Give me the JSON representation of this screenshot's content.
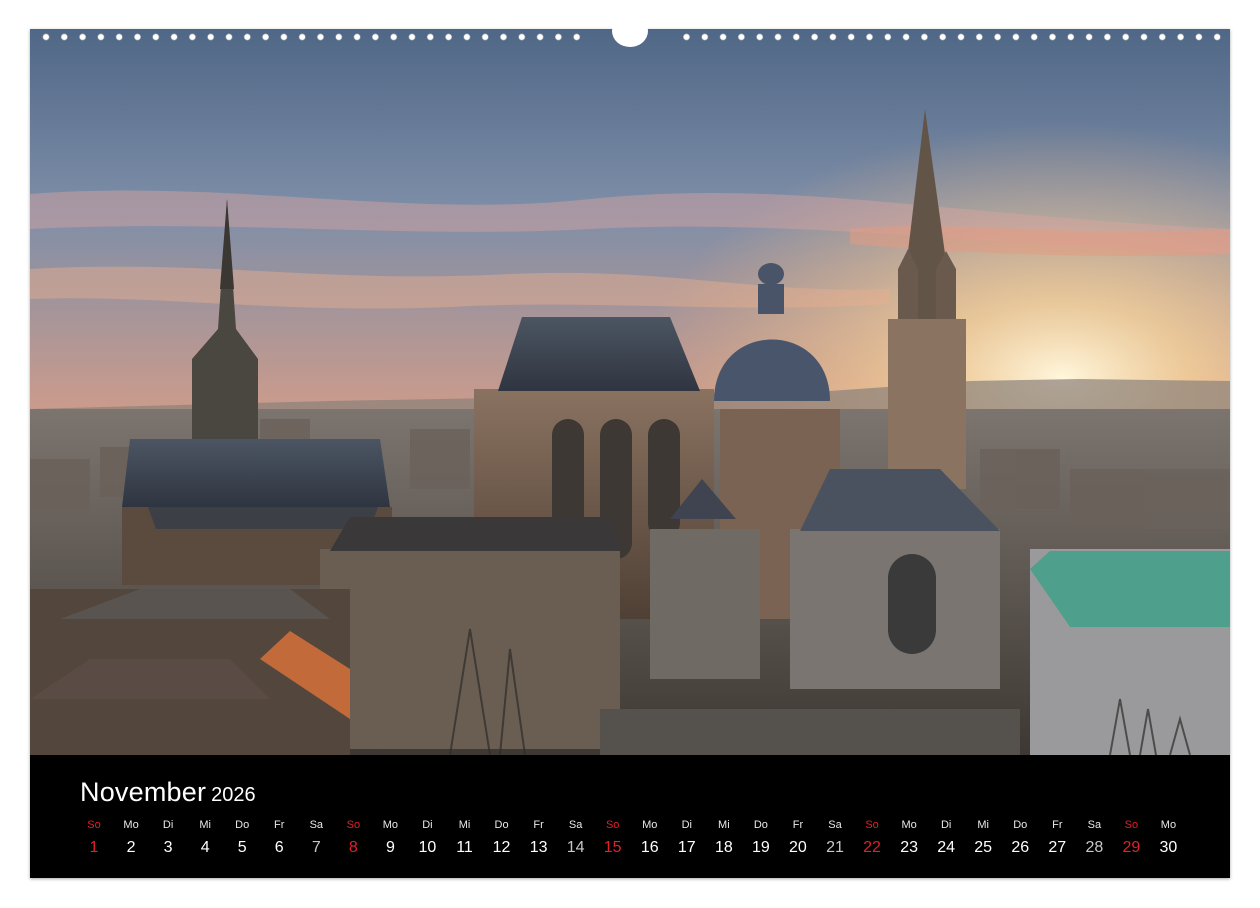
{
  "calendar": {
    "month": "November",
    "year": "2026",
    "days": [
      {
        "wd": "So",
        "d": "1",
        "type": "sun"
      },
      {
        "wd": "Mo",
        "d": "2",
        "type": "wk"
      },
      {
        "wd": "Di",
        "d": "3",
        "type": "wk"
      },
      {
        "wd": "Mi",
        "d": "4",
        "type": "wk"
      },
      {
        "wd": "Do",
        "d": "5",
        "type": "wk"
      },
      {
        "wd": "Fr",
        "d": "6",
        "type": "wk"
      },
      {
        "wd": "Sa",
        "d": "7",
        "type": "sat"
      },
      {
        "wd": "So",
        "d": "8",
        "type": "sun"
      },
      {
        "wd": "Mo",
        "d": "9",
        "type": "wk"
      },
      {
        "wd": "Di",
        "d": "10",
        "type": "wk"
      },
      {
        "wd": "Mi",
        "d": "11",
        "type": "wk"
      },
      {
        "wd": "Do",
        "d": "12",
        "type": "wk"
      },
      {
        "wd": "Fr",
        "d": "13",
        "type": "wk"
      },
      {
        "wd": "Sa",
        "d": "14",
        "type": "sat"
      },
      {
        "wd": "So",
        "d": "15",
        "type": "sun"
      },
      {
        "wd": "Mo",
        "d": "16",
        "type": "wk"
      },
      {
        "wd": "Di",
        "d": "17",
        "type": "wk"
      },
      {
        "wd": "Mi",
        "d": "18",
        "type": "wk"
      },
      {
        "wd": "Do",
        "d": "19",
        "type": "wk"
      },
      {
        "wd": "Fr",
        "d": "20",
        "type": "wk"
      },
      {
        "wd": "Sa",
        "d": "21",
        "type": "sat"
      },
      {
        "wd": "So",
        "d": "22",
        "type": "sun"
      },
      {
        "wd": "Mo",
        "d": "23",
        "type": "wk"
      },
      {
        "wd": "Di",
        "d": "24",
        "type": "wk"
      },
      {
        "wd": "Mi",
        "d": "25",
        "type": "wk"
      },
      {
        "wd": "Do",
        "d": "26",
        "type": "wk"
      },
      {
        "wd": "Fr",
        "d": "27",
        "type": "wk"
      },
      {
        "wd": "Sa",
        "d": "28",
        "type": "sat"
      },
      {
        "wd": "So",
        "d": "29",
        "type": "sun"
      },
      {
        "wd": "Mo",
        "d": "30",
        "type": "wk"
      }
    ]
  },
  "colors": {
    "sunday": "#e0202a",
    "saturday": "#c8c8c8",
    "weekday": "#ffffff",
    "calendar_bg": "#000000"
  },
  "photo": {
    "subject": "city skyline at sunset with cathedral domes and spires"
  }
}
